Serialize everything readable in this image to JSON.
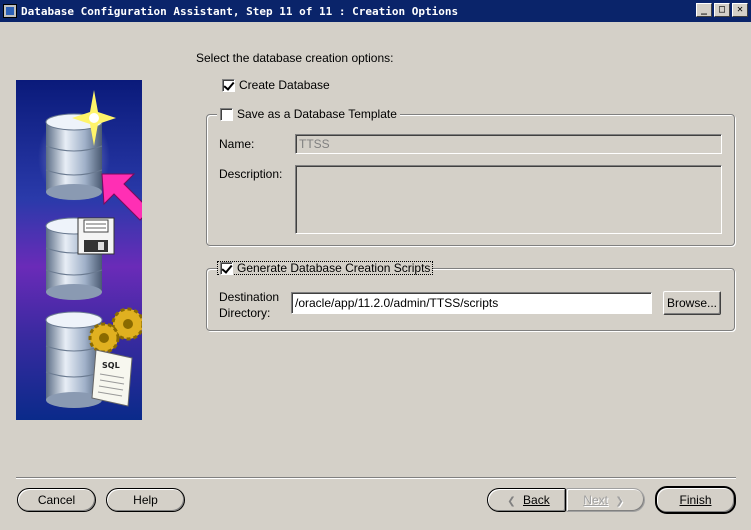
{
  "window": {
    "title": "Database Configuration Assistant, Step 11 of 11 : Creation Options",
    "controls": {
      "minimize": "_",
      "maximize": "□",
      "close": "✕"
    }
  },
  "main": {
    "heading": "Select the database creation options:",
    "create_database": {
      "label": "Create Database",
      "checked": true
    },
    "save_template": {
      "label": "Save as a Database Template",
      "checked": false,
      "name_label": "Name:",
      "name_value": "TTSS",
      "description_label": "Description:",
      "description_value": ""
    },
    "generate_scripts": {
      "label": "Generate Database Creation Scripts",
      "checked": true,
      "destination_label_line1": "Destination",
      "destination_label_line2": "Directory:",
      "destination_value": "/oracle/app/11.2.0/admin/TTSS/scripts",
      "browse_label": "Browse..."
    }
  },
  "footer": {
    "cancel_label": "Cancel",
    "help_label": "Help",
    "back_label": "Back",
    "next_label": "Next",
    "finish_label": "Finish"
  },
  "icons": {
    "database": "database-icon",
    "sparkle": "sparkle-icon",
    "arrow": "pointer-arrow-icon",
    "floppy": "floppy-disk-icon",
    "gears": "gears-icon",
    "sql_scroll": "sql-scroll-icon"
  },
  "art_text": {
    "sql": "SQL"
  }
}
